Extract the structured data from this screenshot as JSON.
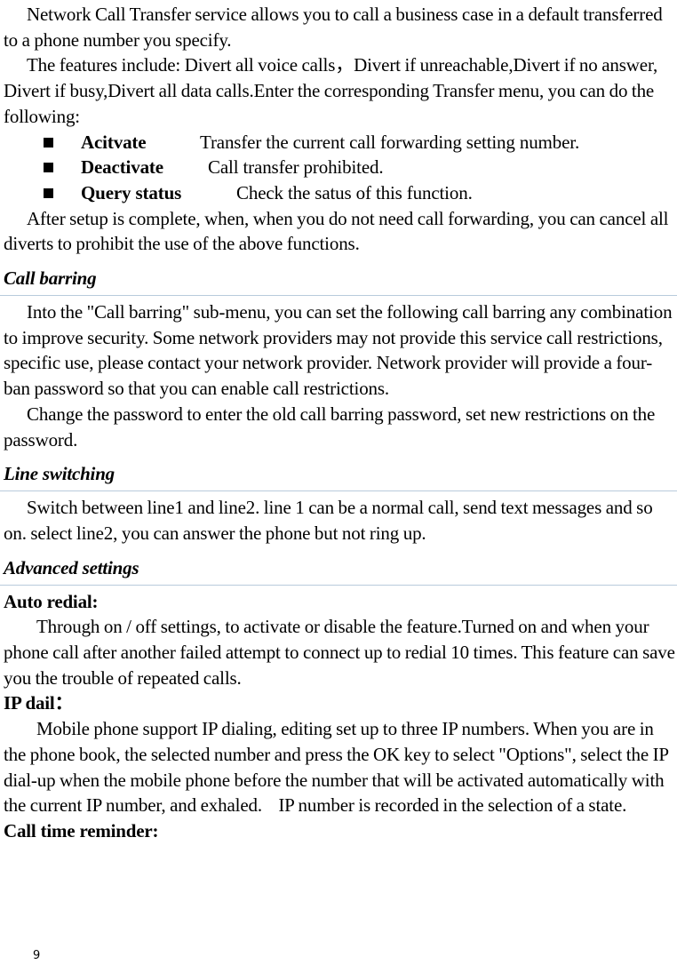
{
  "call_transfer": {
    "para1": "Network Call Transfer service allows you to call a business case in a default transferred to a phone number you specify.",
    "para2": "The features include: Divert all voice calls，Divert if unreachable,Divert if no answer, Divert if busy,Divert all data calls.Enter the corresponding Transfer menu, you can do the following:",
    "options": [
      {
        "term": "Acitvate",
        "desc": "Transfer the current call forwarding setting number."
      },
      {
        "term": "Deactivate",
        "desc": "Call transfer prohibited."
      },
      {
        "term": "Query status",
        "desc": "Check the satus of this function."
      }
    ],
    "para3": "After setup is complete, when, when you do not need call forwarding, you can cancel all diverts to prohibit the use of the above functions."
  },
  "call_barring": {
    "heading": "Call barring",
    "para1": "Into the \"Call barring\" sub-menu, you can set the following call barring any combination to improve security. Some network providers may not provide this service call restrictions, specific use, please contact your network provider. Network provider will provide a four-ban password so that you can enable call restrictions.",
    "para2": "Change the password to enter the old call barring password, set new restrictions on the password."
  },
  "line_switching": {
    "heading": "Line switching",
    "para1": "Switch between line1 and line2. line 1 can be a normal call, send text messages and so on. select line2, you can answer the phone but not ring up."
  },
  "advanced_settings": {
    "heading": "Advanced settings",
    "auto_redial": {
      "title": "Auto redial:",
      "text": "Through on / off settings, to activate or disable the feature.Turned on and when your phone call after another failed attempt to connect up to redial 10 times. This feature can save you the trouble of repeated calls."
    },
    "ip_dial": {
      "title": "IP dail：",
      "text": "Mobile phone support IP dialing, editing set up to three IP numbers. When you are in the phone book, the selected number and press the OK key to select \"Options\", select the IP dial-up when the mobile phone before the number that will be activated automatically with the current IP number, and exhaled.    IP number is recorded in the selection of a state."
    },
    "call_time_reminder": {
      "title": "Call time reminder:"
    }
  },
  "footer": {
    "page_number": "9"
  }
}
